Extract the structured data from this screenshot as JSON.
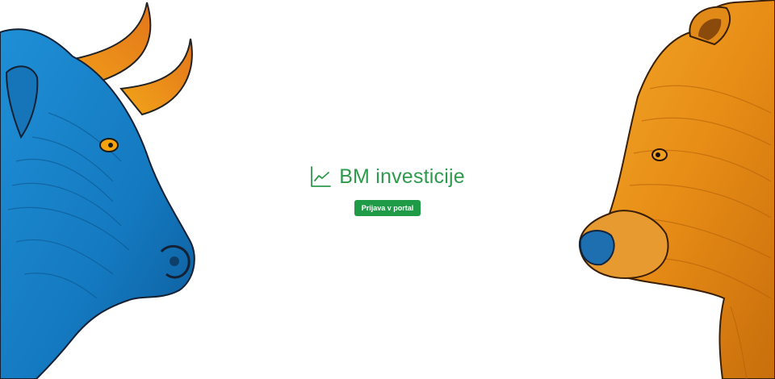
{
  "brand": {
    "name": "BM investicije",
    "icon": "line-chart-icon",
    "color": "#2e9a4e"
  },
  "login_button": {
    "label": "Prijava v portal",
    "background": "#1f9a46"
  },
  "illustrations": {
    "left": "bull-head",
    "right": "bear-head"
  }
}
